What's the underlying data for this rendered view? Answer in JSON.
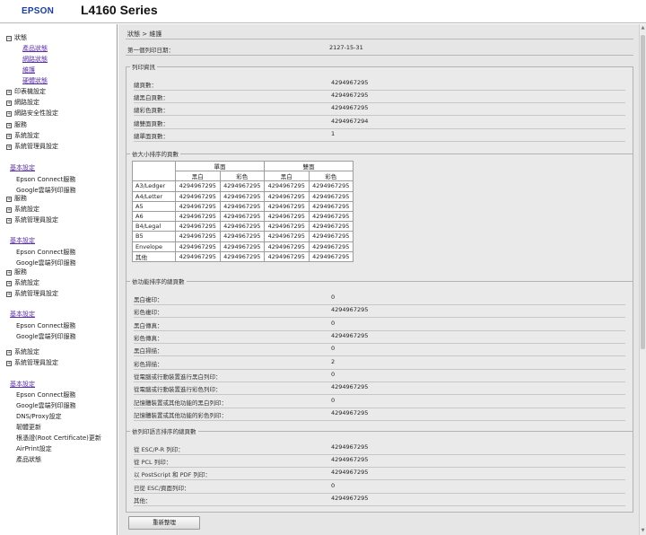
{
  "header": {
    "logo": "EPSON",
    "model": "L4160 Series"
  },
  "sidebar": {
    "status": "狀態",
    "status_sub": [
      "產品狀態",
      "網路狀態",
      "維護",
      "硬體狀態"
    ],
    "groups_a": [
      "印表機設定",
      "網路設定",
      "網路安全性設定",
      "服務",
      "系統設定",
      "系統管理員設定"
    ],
    "basic": "基本設定",
    "epson_connect": "Epson Connect服務",
    "google_cloud": "Google雲端列印服務",
    "service": "服務",
    "system": "系統設定",
    "admin": "系統管理員設定",
    "dns_proxy": "DNS/Proxy設定",
    "firmware": "韌體更新",
    "root_cert": "根憑證(Root Certificate)更新",
    "airprint": "AirPrint設定",
    "product_status": "產品狀態"
  },
  "main": {
    "breadcrumb": "狀態 > 維護",
    "first_print_label": "第一個列印日期：",
    "first_print_value": "2127-15-31",
    "print_info": {
      "title": "列印資訊",
      "rows": [
        {
          "label": "總頁數：",
          "value": "4294967295"
        },
        {
          "label": "總黑白頁數：",
          "value": "4294967295"
        },
        {
          "label": "總彩色頁數：",
          "value": "4294967295"
        },
        {
          "label": "總雙面頁數：",
          "value": "4294967294"
        },
        {
          "label": "總單面頁數：",
          "value": "1"
        }
      ]
    },
    "size_table": {
      "title": "依大小排序的頁數",
      "col_single": "單面",
      "col_double": "雙面",
      "mono": "黑白",
      "color": "彩色",
      "rows": [
        {
          "name": "A3/Ledger",
          "v": [
            "4294967295",
            "4294967295",
            "4294967295",
            "4294967295"
          ]
        },
        {
          "name": "A4/Letter",
          "v": [
            "4294967295",
            "4294967295",
            "4294967295",
            "4294967295"
          ]
        },
        {
          "name": "A5",
          "v": [
            "4294967295",
            "4294967295",
            "4294967295",
            "4294967295"
          ]
        },
        {
          "name": "A6",
          "v": [
            "4294967295",
            "4294967295",
            "4294967295",
            "4294967295"
          ]
        },
        {
          "name": "B4/Legal",
          "v": [
            "4294967295",
            "4294967295",
            "4294967295",
            "4294967295"
          ]
        },
        {
          "name": "B5",
          "v": [
            "4294967295",
            "4294967295",
            "4294967295",
            "4294967295"
          ]
        },
        {
          "name": "Envelope",
          "v": [
            "4294967295",
            "4294967295",
            "4294967295",
            "4294967295"
          ]
        },
        {
          "name": "其他",
          "v": [
            "4294967295",
            "4294967295",
            "4294967295",
            "4294967295"
          ]
        }
      ]
    },
    "function": {
      "title": "依功能排序的總頁數",
      "rows": [
        {
          "label": "黑白複印：",
          "value": "0"
        },
        {
          "label": "彩色複印：",
          "value": "4294967295"
        },
        {
          "label": "黑白傳真：",
          "value": "0"
        },
        {
          "label": "彩色傳真：",
          "value": "4294967295"
        },
        {
          "label": "黑白掃描：",
          "value": "0"
        },
        {
          "label": "彩色掃描：",
          "value": "2"
        },
        {
          "label": "從電腦或行動裝置進行黑白列印：",
          "value": "0"
        },
        {
          "label": "從電腦或行動裝置進行彩色列印：",
          "value": "4294967295"
        },
        {
          "label": "記憶體裝置或其他功能的黑白列印：",
          "value": "0"
        },
        {
          "label": "記憶體裝置或其他功能的彩色列印：",
          "value": "4294967295"
        }
      ]
    },
    "language": {
      "title": "依列印語言排序的總頁數",
      "rows": [
        {
          "label": "從 ESC/P-R 列印：",
          "value": "4294967295"
        },
        {
          "label": "從 PCL 列印：",
          "value": "4294967295"
        },
        {
          "label": "以 PostScript 和 PDF 列印：",
          "value": "4294967295"
        },
        {
          "label": "已從 ESC/頁面列印：",
          "value": "0"
        },
        {
          "label": "其他：",
          "value": "4294967295"
        }
      ]
    },
    "refresh_button": "重新整理"
  }
}
